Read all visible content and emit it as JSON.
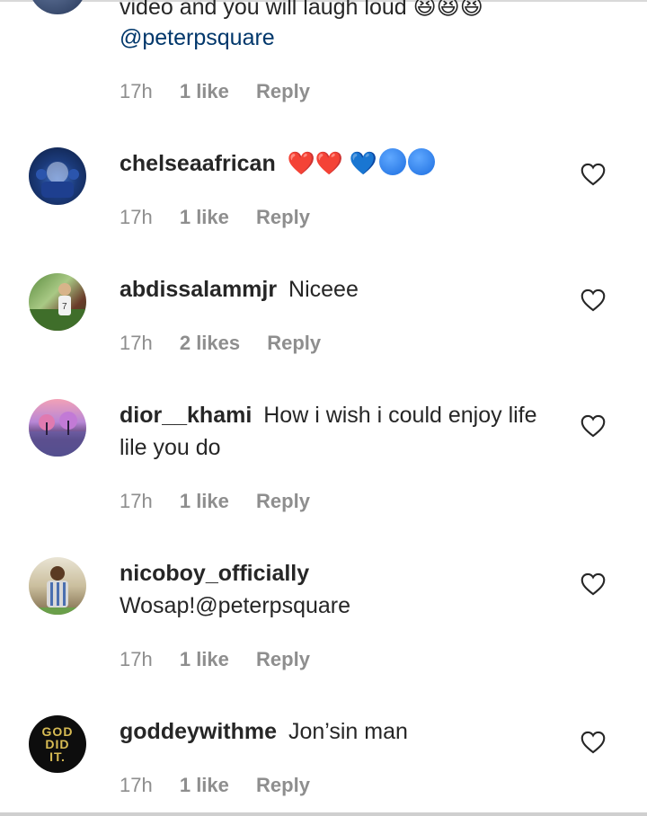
{
  "partial_comment": {
    "text_cutoff": "video and you will laugh loud 😆😆😆",
    "mention": "@peterpsquare",
    "time": "17h",
    "likes": "1 like",
    "reply": "Reply"
  },
  "comments": [
    {
      "username": "chelseaafrican",
      "text": "",
      "time": "17h",
      "likes": "1 like",
      "reply": "Reply"
    },
    {
      "username": "abdissalammjr",
      "text": "Niceee",
      "time": "17h",
      "likes": "2 likes",
      "reply": "Reply"
    },
    {
      "username": "dior__khami",
      "text": "How i wish i could enjoy life lile you do",
      "time": "17h",
      "likes": "1 like",
      "reply": "Reply"
    },
    {
      "username": "nicoboy_officially",
      "text": "Wosap!@peterpsquare",
      "time": "17h",
      "likes": "1 like",
      "reply": "Reply"
    },
    {
      "username": "goddeywithme",
      "text": "Jon’sin man",
      "time": "17h",
      "likes": "1 like",
      "reply": "Reply"
    }
  ],
  "avatar_logo_text": "GOD DID IT.",
  "colors": {
    "text": "#262626",
    "meta": "#8e8e8e",
    "mention": "#00376b"
  },
  "icons": {
    "like": "heart-outline-icon"
  }
}
